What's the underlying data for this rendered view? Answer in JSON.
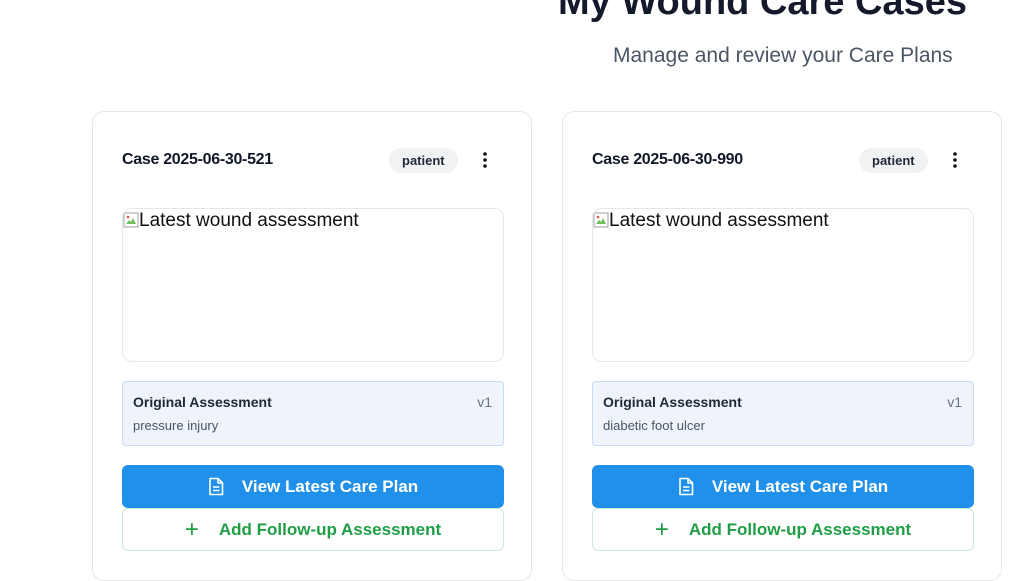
{
  "header": {
    "title": "My Wound Care Cases",
    "subtitle": "Manage and review your Care Plans"
  },
  "cases": [
    {
      "case_id": "Case 2025-06-30-521",
      "role": "patient",
      "image_alt": "Latest wound assessment",
      "assessment_label": "Original Assessment",
      "version": "v1",
      "wound_type": "pressure injury",
      "view_button": "View Latest Care Plan",
      "add_button": "Add Follow-up Assessment"
    },
    {
      "case_id": "Case 2025-06-30-990",
      "role": "patient",
      "image_alt": "Latest wound assessment",
      "assessment_label": "Original Assessment",
      "version": "v1",
      "wound_type": "diabetic foot ulcer",
      "view_button": "View Latest Care Plan",
      "add_button": "Add Follow-up Assessment"
    }
  ],
  "icons": {
    "more": "vertical-ellipsis-icon",
    "document": "document-icon",
    "plus": "plus-icon",
    "broken_image": "broken-image-icon"
  },
  "colors": {
    "primary": "#2190ea",
    "success": "#1f9e45",
    "assessment_bg": "#eef3fc"
  }
}
